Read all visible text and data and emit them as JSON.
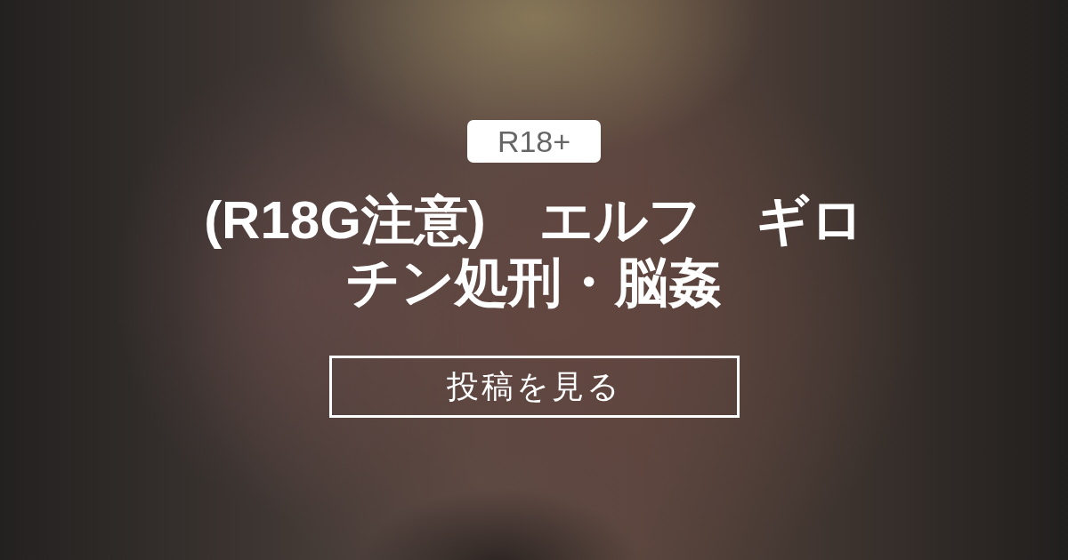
{
  "badge": "R18+",
  "title": "(R18G注意)　エルフ　ギロチン処刑・脳姦",
  "button": {
    "label": "投稿を見る"
  }
}
